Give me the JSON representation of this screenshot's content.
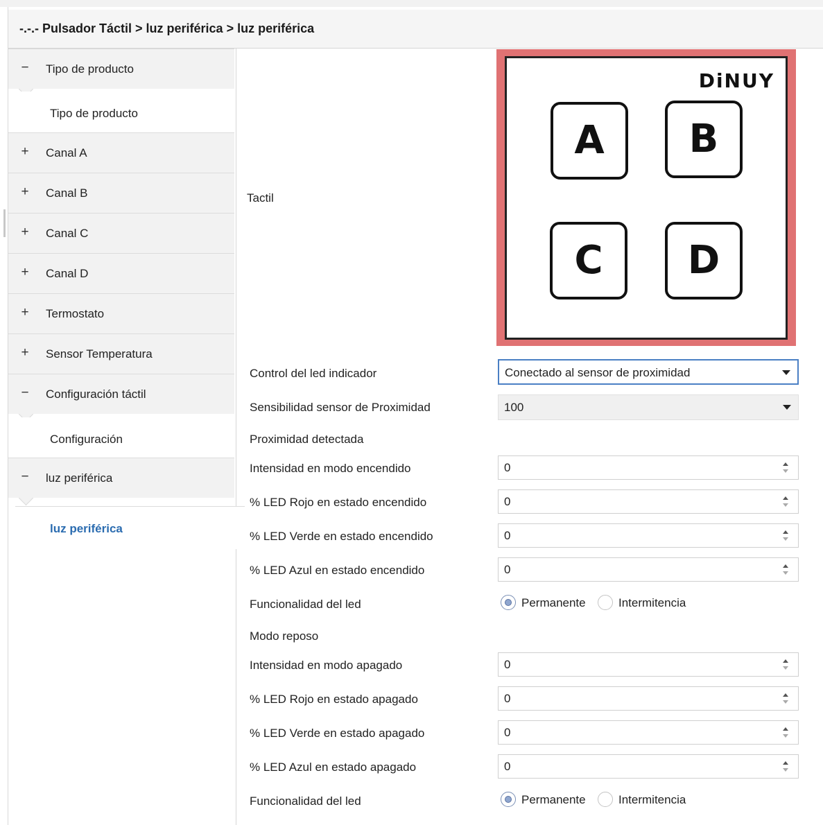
{
  "breadcrumb": "-.-.- Pulsador Táctil > luz periférica > luz periférica",
  "sidebar": {
    "items": [
      {
        "symbol": "−",
        "label": "Tipo de producto",
        "expanded": true
      },
      {
        "label": "Tipo de producto"
      },
      {
        "symbol": "+",
        "label": "Canal A"
      },
      {
        "symbol": "+",
        "label": "Canal B"
      },
      {
        "symbol": "+",
        "label": "Canal C"
      },
      {
        "symbol": "+",
        "label": "Canal D"
      },
      {
        "symbol": "+",
        "label": "Termostato"
      },
      {
        "symbol": "+",
        "label": "Sensor Temperatura"
      },
      {
        "symbol": "−",
        "label": "Configuración táctil",
        "expanded": true
      },
      {
        "label": "Configuración"
      },
      {
        "symbol": "−",
        "label": "luz periférica",
        "expanded": true
      },
      {
        "label": "luz periférica",
        "active": true
      }
    ]
  },
  "device": {
    "label": "Tactil",
    "logo": "DiNUY",
    "keys": [
      "A",
      "B",
      "C",
      "D"
    ],
    "frame_color": "#e07273"
  },
  "form": {
    "control_led_label": "Control del led indicador",
    "control_led_value": "Conectado al sensor de proximidad",
    "sensibilidad_label": "Sensibilidad sensor de Proximidad",
    "sensibilidad_value": "100",
    "section_proximidad": "Proximidad detectada",
    "section_reposo": "Modo reposo",
    "on_rows": [
      {
        "label": "Intensidad en modo encendido",
        "value": "0"
      },
      {
        "label": "% LED Rojo en estado encendido",
        "value": "0"
      },
      {
        "label": "% LED Verde en estado encendido",
        "value": "0"
      },
      {
        "label": "% LED Azul en estado encendido",
        "value": "0"
      }
    ],
    "off_rows": [
      {
        "label": "Intensidad en modo apagado",
        "value": "0"
      },
      {
        "label": "% LED Rojo en estado apagado",
        "value": "0"
      },
      {
        "label": "% LED Verde en estado apagado",
        "value": "0"
      },
      {
        "label": "% LED Azul en estado apagado",
        "value": "0"
      }
    ],
    "func_label": "Funcionalidad del led",
    "radio_options": [
      "Permanente",
      "Intermitencia"
    ],
    "func_on_selected": "Permanente",
    "func_off_selected": "Permanente"
  }
}
